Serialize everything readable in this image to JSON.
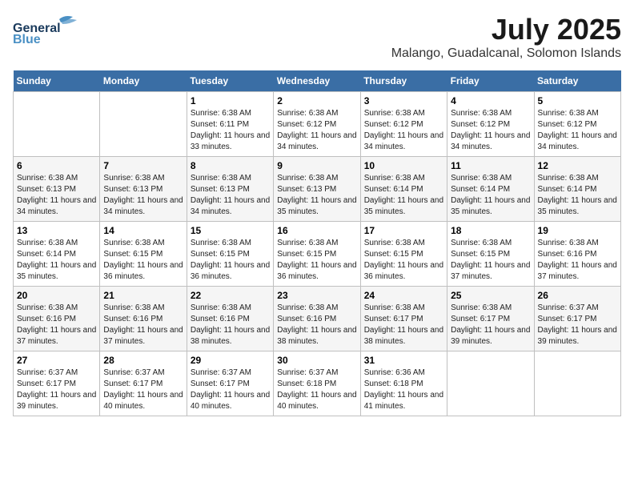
{
  "header": {
    "logo": {
      "line1": "General",
      "line2": "Blue"
    },
    "title": "July 2025",
    "location": "Malango, Guadalcanal, Solomon Islands"
  },
  "weekdays": [
    "Sunday",
    "Monday",
    "Tuesday",
    "Wednesday",
    "Thursday",
    "Friday",
    "Saturday"
  ],
  "weeks": [
    [
      {
        "day": "",
        "info": ""
      },
      {
        "day": "",
        "info": ""
      },
      {
        "day": "1",
        "info": "Sunrise: 6:38 AM\nSunset: 6:11 PM\nDaylight: 11 hours and 33 minutes."
      },
      {
        "day": "2",
        "info": "Sunrise: 6:38 AM\nSunset: 6:12 PM\nDaylight: 11 hours and 34 minutes."
      },
      {
        "day": "3",
        "info": "Sunrise: 6:38 AM\nSunset: 6:12 PM\nDaylight: 11 hours and 34 minutes."
      },
      {
        "day": "4",
        "info": "Sunrise: 6:38 AM\nSunset: 6:12 PM\nDaylight: 11 hours and 34 minutes."
      },
      {
        "day": "5",
        "info": "Sunrise: 6:38 AM\nSunset: 6:12 PM\nDaylight: 11 hours and 34 minutes."
      }
    ],
    [
      {
        "day": "6",
        "info": "Sunrise: 6:38 AM\nSunset: 6:13 PM\nDaylight: 11 hours and 34 minutes."
      },
      {
        "day": "7",
        "info": "Sunrise: 6:38 AM\nSunset: 6:13 PM\nDaylight: 11 hours and 34 minutes."
      },
      {
        "day": "8",
        "info": "Sunrise: 6:38 AM\nSunset: 6:13 PM\nDaylight: 11 hours and 34 minutes."
      },
      {
        "day": "9",
        "info": "Sunrise: 6:38 AM\nSunset: 6:13 PM\nDaylight: 11 hours and 35 minutes."
      },
      {
        "day": "10",
        "info": "Sunrise: 6:38 AM\nSunset: 6:14 PM\nDaylight: 11 hours and 35 minutes."
      },
      {
        "day": "11",
        "info": "Sunrise: 6:38 AM\nSunset: 6:14 PM\nDaylight: 11 hours and 35 minutes."
      },
      {
        "day": "12",
        "info": "Sunrise: 6:38 AM\nSunset: 6:14 PM\nDaylight: 11 hours and 35 minutes."
      }
    ],
    [
      {
        "day": "13",
        "info": "Sunrise: 6:38 AM\nSunset: 6:14 PM\nDaylight: 11 hours and 35 minutes."
      },
      {
        "day": "14",
        "info": "Sunrise: 6:38 AM\nSunset: 6:15 PM\nDaylight: 11 hours and 36 minutes."
      },
      {
        "day": "15",
        "info": "Sunrise: 6:38 AM\nSunset: 6:15 PM\nDaylight: 11 hours and 36 minutes."
      },
      {
        "day": "16",
        "info": "Sunrise: 6:38 AM\nSunset: 6:15 PM\nDaylight: 11 hours and 36 minutes."
      },
      {
        "day": "17",
        "info": "Sunrise: 6:38 AM\nSunset: 6:15 PM\nDaylight: 11 hours and 36 minutes."
      },
      {
        "day": "18",
        "info": "Sunrise: 6:38 AM\nSunset: 6:15 PM\nDaylight: 11 hours and 37 minutes."
      },
      {
        "day": "19",
        "info": "Sunrise: 6:38 AM\nSunset: 6:16 PM\nDaylight: 11 hours and 37 minutes."
      }
    ],
    [
      {
        "day": "20",
        "info": "Sunrise: 6:38 AM\nSunset: 6:16 PM\nDaylight: 11 hours and 37 minutes."
      },
      {
        "day": "21",
        "info": "Sunrise: 6:38 AM\nSunset: 6:16 PM\nDaylight: 11 hours and 37 minutes."
      },
      {
        "day": "22",
        "info": "Sunrise: 6:38 AM\nSunset: 6:16 PM\nDaylight: 11 hours and 38 minutes."
      },
      {
        "day": "23",
        "info": "Sunrise: 6:38 AM\nSunset: 6:16 PM\nDaylight: 11 hours and 38 minutes."
      },
      {
        "day": "24",
        "info": "Sunrise: 6:38 AM\nSunset: 6:17 PM\nDaylight: 11 hours and 38 minutes."
      },
      {
        "day": "25",
        "info": "Sunrise: 6:38 AM\nSunset: 6:17 PM\nDaylight: 11 hours and 39 minutes."
      },
      {
        "day": "26",
        "info": "Sunrise: 6:37 AM\nSunset: 6:17 PM\nDaylight: 11 hours and 39 minutes."
      }
    ],
    [
      {
        "day": "27",
        "info": "Sunrise: 6:37 AM\nSunset: 6:17 PM\nDaylight: 11 hours and 39 minutes."
      },
      {
        "day": "28",
        "info": "Sunrise: 6:37 AM\nSunset: 6:17 PM\nDaylight: 11 hours and 40 minutes."
      },
      {
        "day": "29",
        "info": "Sunrise: 6:37 AM\nSunset: 6:17 PM\nDaylight: 11 hours and 40 minutes."
      },
      {
        "day": "30",
        "info": "Sunrise: 6:37 AM\nSunset: 6:18 PM\nDaylight: 11 hours and 40 minutes."
      },
      {
        "day": "31",
        "info": "Sunrise: 6:36 AM\nSunset: 6:18 PM\nDaylight: 11 hours and 41 minutes."
      },
      {
        "day": "",
        "info": ""
      },
      {
        "day": "",
        "info": ""
      }
    ]
  ]
}
